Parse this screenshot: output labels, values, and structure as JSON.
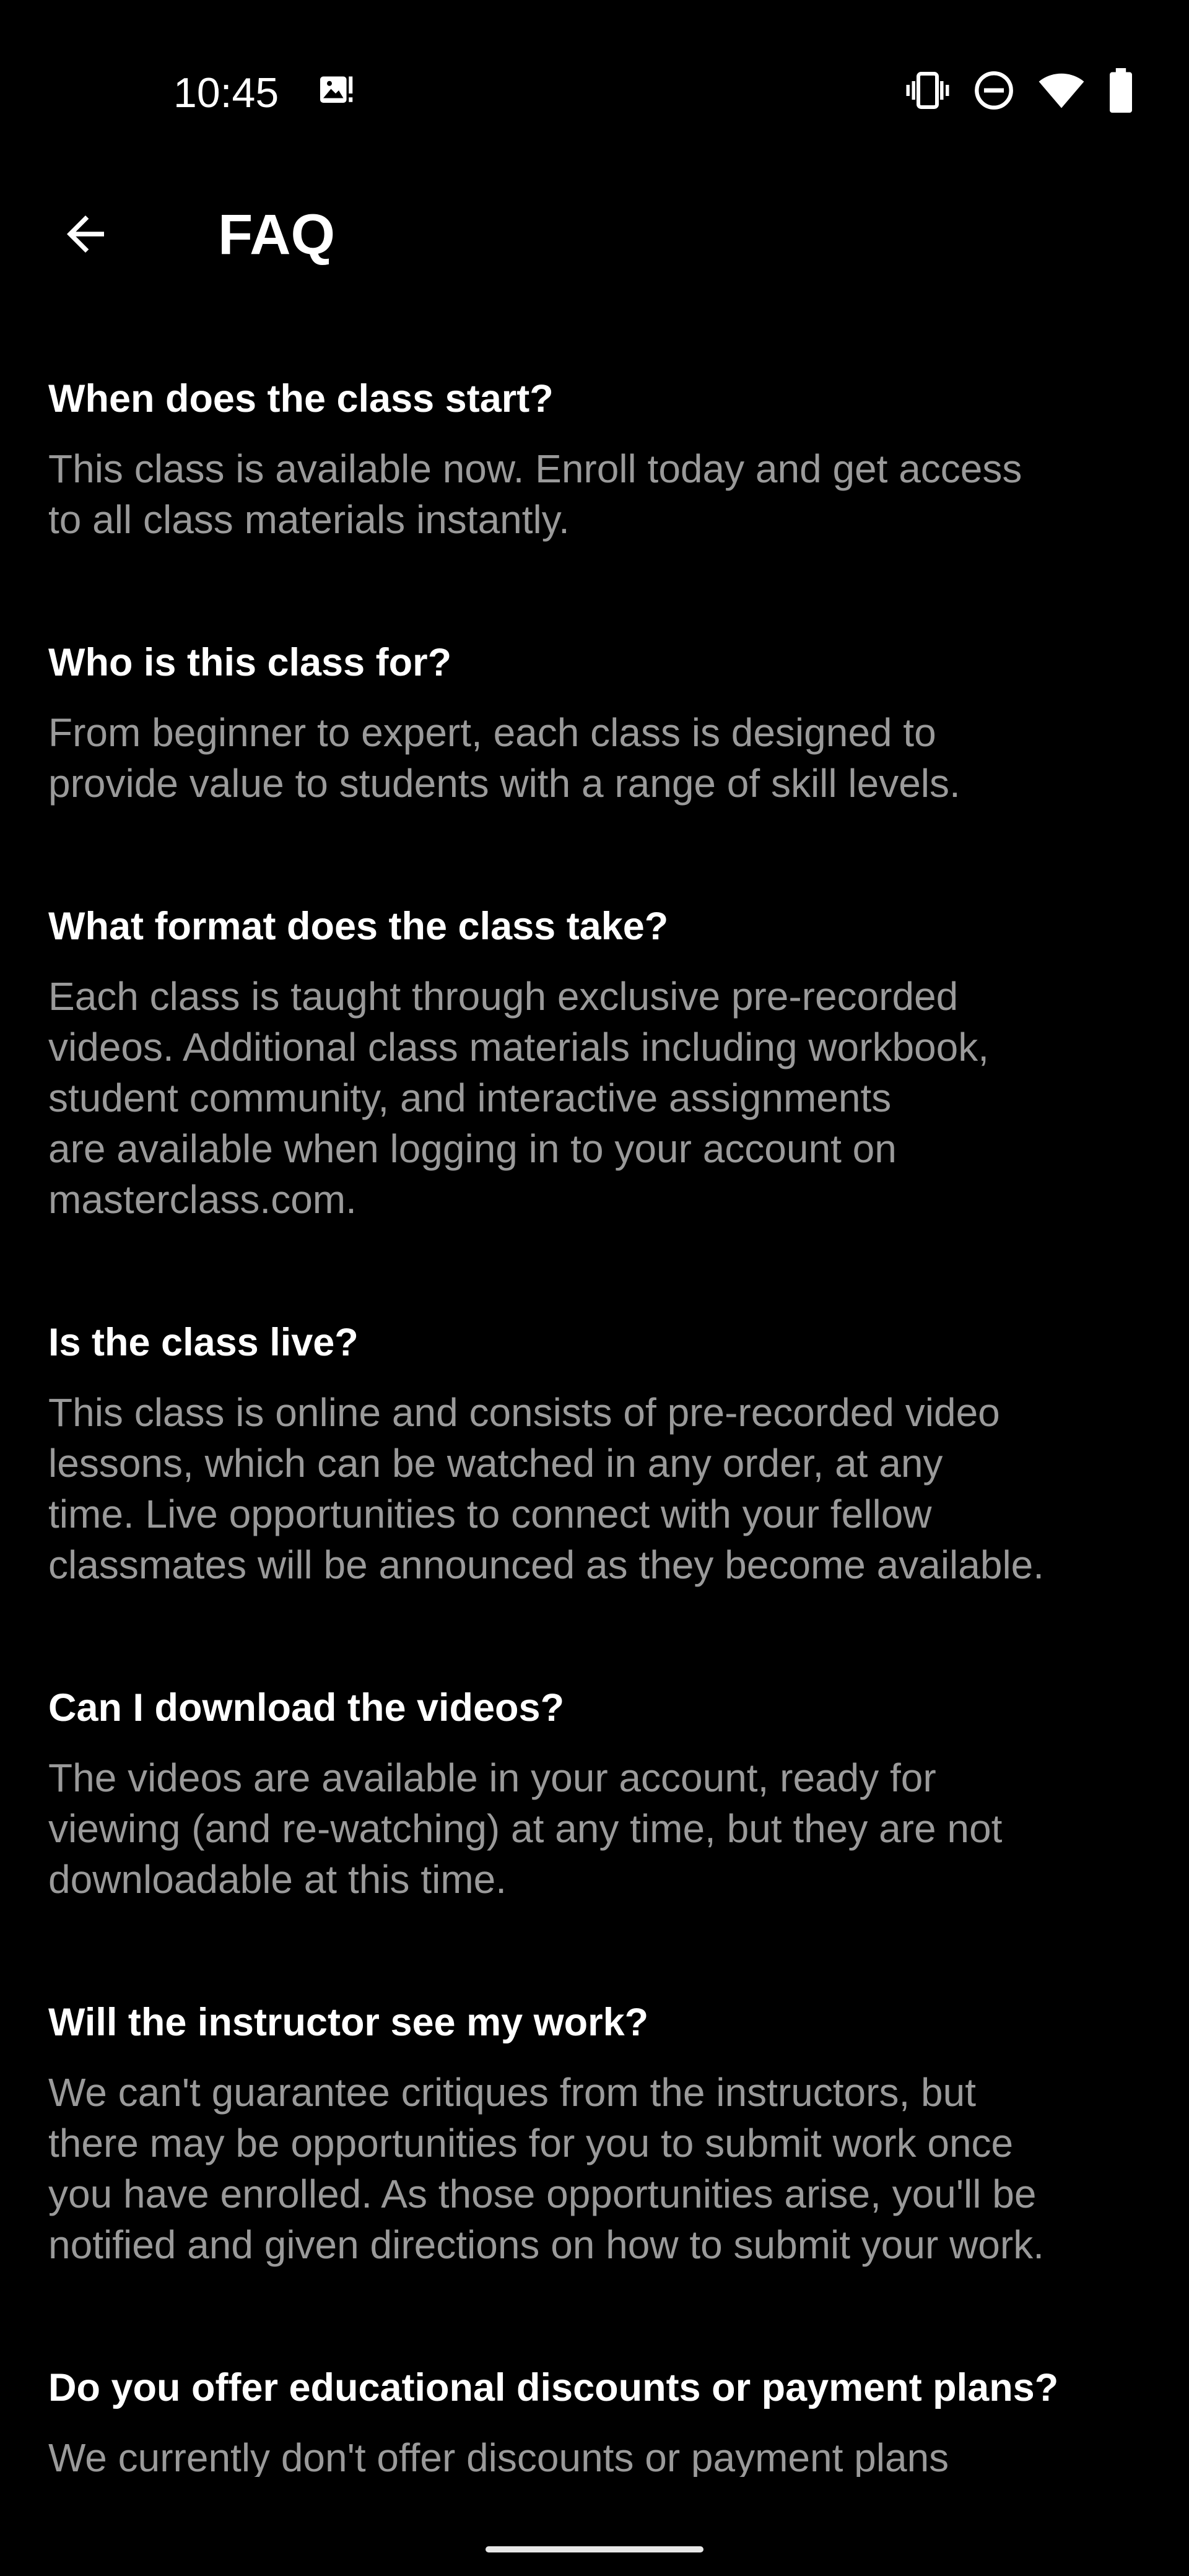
{
  "status_bar": {
    "time": "10:45",
    "icons": [
      "gallery-notification-icon",
      "vibrate-icon",
      "do-not-disturb-icon",
      "wifi-icon",
      "battery-icon"
    ]
  },
  "app_bar": {
    "back_icon": "arrow-left-icon",
    "title": "FAQ"
  },
  "faq": [
    {
      "question": "When does the class start?",
      "answer": "This class is available now. Enroll today and get access\nto all class materials instantly."
    },
    {
      "question": "Who is this class for?",
      "answer": "From beginner to expert, each class is designed to\nprovide value to students with a range of skill levels."
    },
    {
      "question": "What format does the class take?",
      "answer": "Each class is taught through exclusive pre-recorded\nvideos. Additional class materials including workbook,\nstudent community, and interactive assignments\nare available when logging in to your account on\nmasterclass.com."
    },
    {
      "question": "Is the class live?",
      "answer": "This class is online and consists of pre-recorded video\nlessons, which can be watched in any order, at any\ntime. Live opportunities to connect with your fellow\nclassmates will be announced as they become available."
    },
    {
      "question": "Can I download the videos?",
      "answer": "The videos are available in your account, ready for\nviewing (and re-watching) at any time, but they are not\ndownloadable at this time."
    },
    {
      "question": "Will the instructor see my work?",
      "answer": "We can't guarantee critiques from the instructors, but\nthere may be opportunities for you to submit work once\nyou have enrolled. As those opportunities arise, you'll be\nnotified and given directions on how to submit your work."
    },
    {
      "question": "Do you offer educational discounts or payment plans?",
      "answer": "We currently don't offer discounts or payment plans"
    }
  ],
  "colors": {
    "background": "#000000",
    "question_text": "#ffffff",
    "answer_text": "#9a9a9a"
  }
}
